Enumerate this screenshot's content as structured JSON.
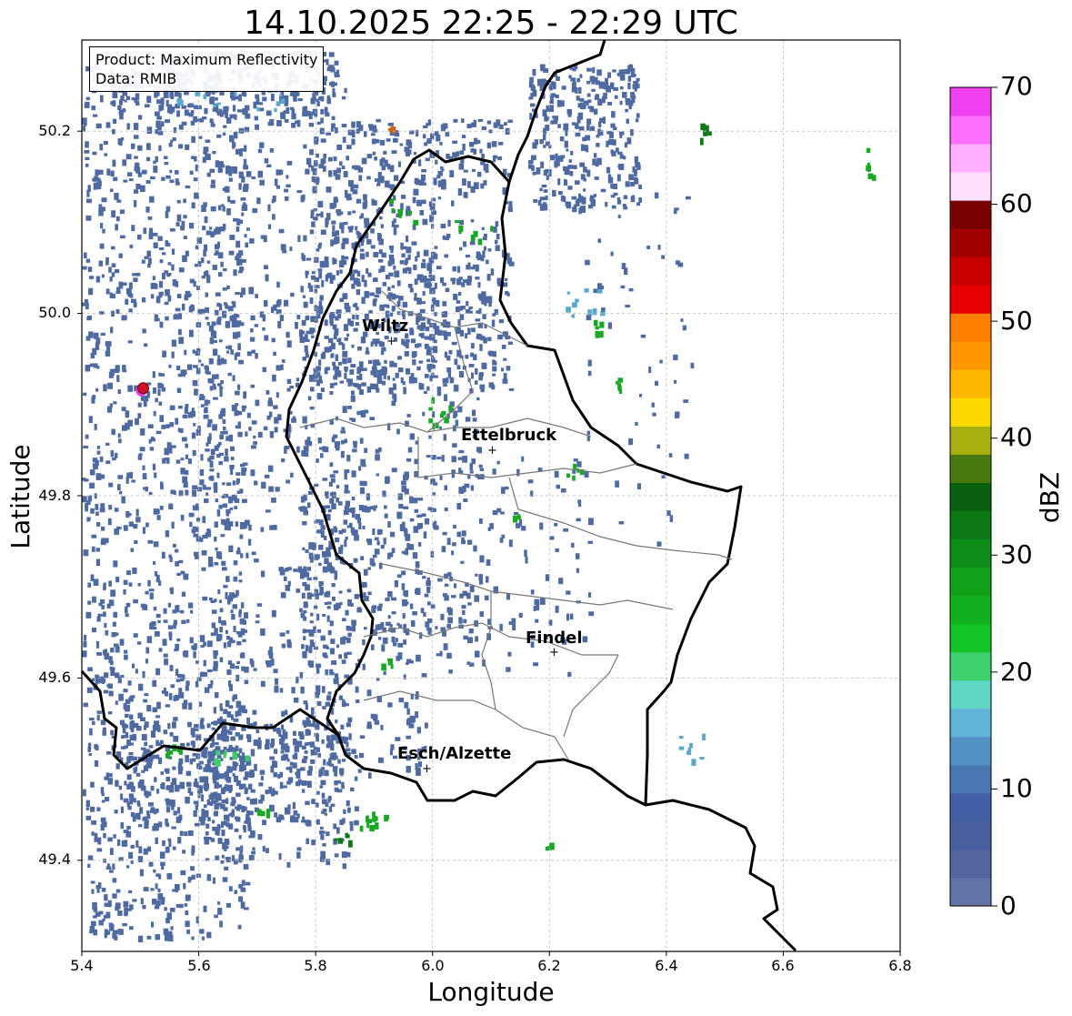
{
  "title": "14.10.2025 22:25 - 22:29 UTC",
  "info": {
    "product": "Product: Maximum Reflectivity",
    "data": "Data: RMIB"
  },
  "axes": {
    "xlabel": "Longitude",
    "ylabel": "Latitude",
    "xlim": [
      5.4,
      6.8
    ],
    "ylim": [
      49.3,
      50.3
    ],
    "xticks": [
      "5.4",
      "5.6",
      "5.8",
      "6.0",
      "6.2",
      "6.4",
      "6.6",
      "6.8"
    ],
    "yticks": [
      "49.4",
      "49.6",
      "49.8",
      "50.0",
      "50.2"
    ],
    "grid": true
  },
  "cities": [
    {
      "name": "Wiltz",
      "lon": 5.93,
      "lat": 49.967
    },
    {
      "name": "Ettelbruck",
      "lon": 6.104,
      "lat": 49.848
    },
    {
      "name": "Findel",
      "lon": 6.21,
      "lat": 49.627
    },
    {
      "name": "Esch/Alzette",
      "lon": 5.99,
      "lat": 49.5
    }
  ],
  "marker": {
    "lon": 5.505,
    "lat": 49.918,
    "color": "#d0102a"
  },
  "colorbar": {
    "label": "dBZ",
    "min": 0,
    "max": 70,
    "ticks": [
      "0",
      "10",
      "20",
      "30",
      "40",
      "50",
      "60",
      "70"
    ],
    "colors": [
      "#6374a8",
      "#5565a0",
      "#4a5fa0",
      "#4260a6",
      "#4a78b4",
      "#5392c4",
      "#5fb4d8",
      "#5ed6c4",
      "#40d070",
      "#12c426",
      "#10b01e",
      "#10a01a",
      "#0e8c18",
      "#0c7814",
      "#086010",
      "#4a7810",
      "#a8b010",
      "#ffd800",
      "#ffb800",
      "#ff9800",
      "#ff8000",
      "#e80000",
      "#c80000",
      "#a00000",
      "#780000",
      "#ffe0ff",
      "#ffb0ff",
      "#ff70ff",
      "#ee40ee"
    ]
  },
  "echo_colors": {
    "weak": "#4f6aa0",
    "moderate": "#5aa8cc",
    "light_green": "#3ccc6a",
    "green": "#18a824",
    "dark_green": "#0e7818",
    "strong": "#d06010"
  }
}
